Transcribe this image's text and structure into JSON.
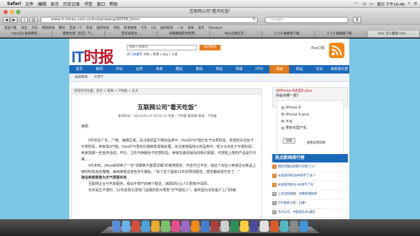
{
  "menubar": {
    "apple": "",
    "items": [
      "Safari",
      "文件",
      "编辑",
      "显示",
      "历史记录",
      "书签",
      "窗口",
      "帮助"
    ],
    "clock": "周日 下午10:46"
  },
  "window": {
    "title": "互联网公司\"看天吃饭\""
  },
  "toolbar": {
    "back": "◀",
    "forward": "▶",
    "reload": "↻",
    "url": "www.it-times.com.cn/hulianwang/42556.jhtml",
    "search_placeholder": "Google"
  },
  "bookmarks": [
    "奥运气象",
    "淘宝",
    "京东",
    "网易新闻",
    "腾讯",
    "百度一下",
    "新浪",
    "国际贸易",
    "手机",
    "新浪微博",
    "今天",
    "GD",
    "国际新闻",
    "一天",
    "苹果",
    "盈丰",
    "PlanAyer"
  ],
  "tabs": [
    "mac怎么录屏教程...",
    "重要文章（北京）气...",
    "苏东坡英文...",
    "屏幕截图软件使用...",
    "Mac怎样打开...",
    "2.3.0 破解版下载...",
    "2.3.0 破解版下载...",
    "mac 怎么截图 mac..."
  ],
  "site": {
    "logo_it": "IT",
    "logo_cn": "时报",
    "search_placeholder": "请输入关键词",
    "search_button": "站内搜索",
    "quick_links_label": "热门关键字",
    "quick_links": "手机 | 苹果 | App | 三星",
    "rss": "Rss订阅",
    "nav": [
      "首页",
      "新闻",
      "评论",
      "业界",
      "电商",
      "酷玩",
      "数码",
      "热站",
      "网事",
      "IPTV",
      "漫画",
      "热站",
      "论坛",
      "读者俱乐部"
    ],
    "nav_active_index": 10,
    "subnav": [
      "画说新闻",
      "大笑IT"
    ],
    "breadcrumb": "您现在的位置：首页 > 新闻 > IT时报 > 正文",
    "article": {
      "title": "互联网公司\"看天吃饭\"",
      "meta": "发布时间：2014-09-14 19:20:13   作者：IT时报 魏英静   来源：IT时报",
      "summary_label": "摘要：",
      "paragraphs": [
        {
          "text": "9月份在广东、广西、海南区域，关注度前呈下降的品类中，Polo衫与T恤已处于淡季阶段，而雪纺衫还处于平季阶段，卖家需对T恤、Polo衫与雪纺衫做新款促销处理。关注度增幅较大的品类中，呢子大衣处于平季阶段，卖家需做一些宣传活动，开衫、卫衣与西服处于旺季阶段，卖家应做促销活动吸引顾客，可感知上架的产品是牛仔裤……",
          "bold": false
        },
        {
          "text": "9月末到，Alice就收到了一份\"详细到不能再详细\"的某类报告，开店不过半年，她这个淘宝小卖家还对新品上架的时机有些懵懂。每到换季总有些手忙脚乱。\"有了这个提前15天的预测报告，感觉胸有成竹多了。\"",
          "bold": false
        },
        {
          "text": "淘宝卖家愿意为天气预报买单",
          "bold": true
        },
        {
          "text": "互联网企业与气象服务，看似不相干的两个概念，渊源却比让人们想象中深厚。",
          "bold": false
        },
        {
          "text": "也许是生不逢时，12年前曾引发热门话题的影片刚发\"天气疑犯人\"，最终因为没有客户上门而销",
          "bold": false
        }
      ]
    },
    "side_ad": {
      "title": "买iPhone 6还是6 plus",
      "subtitle": "你会买哪一款？",
      "options": [
        "iPhone 6",
        "iPhone 6 plus",
        "不买",
        "果粉买国产机"
      ],
      "vote": "投票",
      "results": "查看投票结果"
    },
    "hot": {
      "title": "热点新闻排行榜",
      "items": [
        {
          "num": "1",
          "text": "刷脸的微信和银行开始了么？"
        },
        {
          "num": "2",
          "text": "长城宽带移动4M铁不了多少"
        },
        {
          "num": "3",
          "text": "长城宽带移动 4M宽不了有"
        },
        {
          "num": "4",
          "text": "上海消协提醒：消费者慎防明"
        },
        {
          "num": "5",
          "text": "IT时报第三期：出路？"
        },
        {
          "num": "6",
          "text": "华为公司：中国电信4G通信"
        },
        {
          "num": "7",
          "text": "魅族MX3评测：微工业设计"
        }
      ]
    }
  },
  "dock": {
    "icon_colors": [
      "#5b8fd6",
      "#6bb0e8",
      "#d64d3b",
      "#4aa3e0",
      "#eaaa2a",
      "#7bc26a",
      "#e84c8b",
      "#9c65c9",
      "#f08a12",
      "#3f7fd3",
      "#ad3f3f",
      "#cfcfcf",
      "#2d8f5a",
      "#ffcf3a",
      "#4a4a9c",
      "#e0e0e0",
      "#de5a24",
      "#4fb7c6",
      "#8a8a8a",
      "#3f96d8"
    ]
  }
}
